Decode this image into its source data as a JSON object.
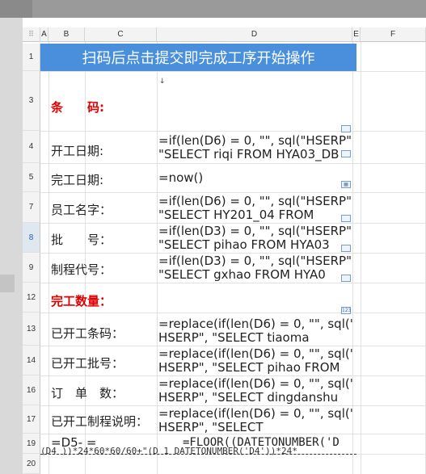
{
  "columns": [
    "A",
    "B",
    "C",
    "D",
    "E",
    "F"
  ],
  "rows": [
    "1",
    "3",
    "4",
    "5",
    "7",
    "8",
    "9",
    "12",
    "13",
    "14",
    "16",
    "17",
    "19",
    "20"
  ],
  "selected_row": "8",
  "banner_text": "扫码后点击提交即完成工序开始操作",
  "fields": [
    {
      "row": "3",
      "label": "条　　码:",
      "value": "",
      "red": true
    },
    {
      "row": "4",
      "label": "开工日期:",
      "value": "=if(len(D6) = 0, \"\", sql(\"HSERP\",\n\"SELECT riqi FROM HYA03_DB"
    },
    {
      "row": "5",
      "label": "完工日期:",
      "value": "=now()"
    },
    {
      "row": "7",
      "label": "员工名字：",
      "value": "=if(len(D6) = 0, \"\", sql(\"HSERP\",\n\"SELECT HY201_04 FROM"
    },
    {
      "row": "8",
      "label": "批　　号：",
      "value": "=if(len(D3) = 0, \"\", sql(\"HSERP\",\n\"SELECT pihao FROM HYA03"
    },
    {
      "row": "9",
      "label": "制程代号：",
      "value": "=if(len(D3) = 0, \"\", sql(\"HSERP\",\n\"SELECT gxhao FROM HYA0"
    },
    {
      "row": "12",
      "label": "完工数量：",
      "value": "",
      "red": true
    },
    {
      "row": "13",
      "label": "已开工条码：",
      "value": "=replace(if(len(D6) = 0, \"\", sql(\"\nHSERP\", \"SELECT tiaoma"
    },
    {
      "row": "14",
      "label": "已开工批号：",
      "value": "=replace(if(len(D6) = 0, \"\", sql(\"\nHSERP\", \"SELECT pihao FROM"
    },
    {
      "row": "16",
      "label": "订　单　数：",
      "value": "=replace(if(len(D6) = 0, \"\", sql(\"\nHSERP\", \"SELECT dingdanshu"
    },
    {
      "row": "17",
      "label": "已开工制程说明：",
      "value": "=replace(if(len(D6) = 0, \"\", sql(\"\nHSERP\", \"SELECT"
    },
    {
      "row": "19",
      "label": "=D5- =",
      "value": "=FLOOR((DATETONUMBER('D"
    }
  ],
  "row19_overflow": "(D4 ))*24*60*60/60+\"(D 1 DATETONUMBER('D4'))*24*",
  "icons": [
    "cell-dropdown-icon",
    "date-picker-icon",
    "number-icon"
  ]
}
